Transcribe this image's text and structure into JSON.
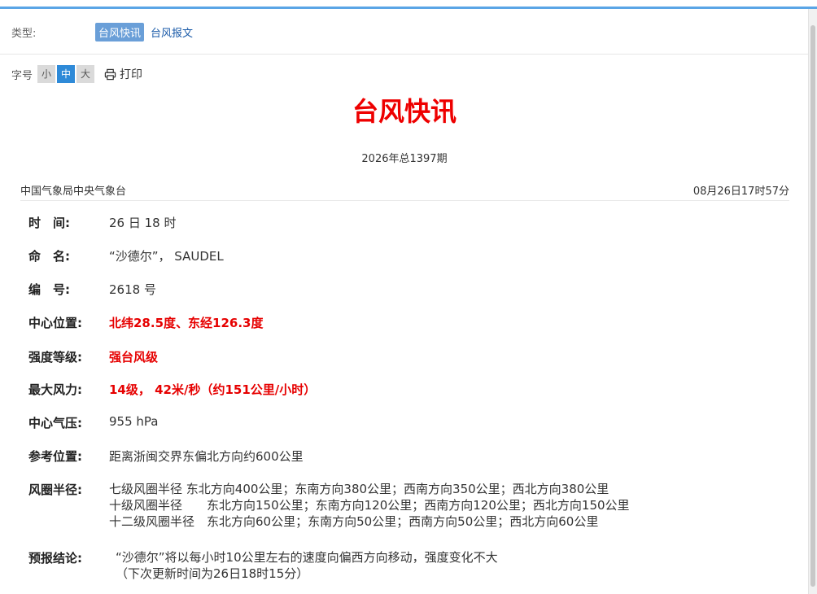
{
  "type_filter": {
    "label": "类型:",
    "active": "台风快讯",
    "other": "台风报文"
  },
  "font_size": {
    "label": "字号",
    "small": "小",
    "medium": "中",
    "large": "大",
    "print": "打印"
  },
  "header": {
    "title": "台风快讯",
    "issue": "2026年总1397期"
  },
  "meta": {
    "org": "中国气象局中央气象台",
    "time": "08月26日17时57分"
  },
  "fields": {
    "time": {
      "label": "时　间:",
      "value": "26 日 18 时"
    },
    "name": {
      "label": "命　名:",
      "value": "“沙德尔”， SAUDEL"
    },
    "number": {
      "label": "编　号:",
      "value": "2618 号"
    },
    "center": {
      "label": "中心位置:",
      "value": "北纬28.5度、东经126.3度"
    },
    "intensity": {
      "label": "强度等级:",
      "value": "强台风级"
    },
    "max_wind": {
      "label": "最大风力:",
      "value": "14级， 42米/秒（约151公里/小时）"
    },
    "pressure": {
      "label": "中心气压:",
      "value": "955 hPa"
    },
    "reference": {
      "label": "参考位置:",
      "value": "距离浙闽交界东偏北方向约600公里"
    },
    "wind_radius": {
      "label": "风圈半径:",
      "lines": [
        "七级风圈半径 东北方向400公里；东南方向380公里；西南方向350公里；西北方向380公里",
        "十级风圈半径　　东北方向150公里；东南方向120公里；西南方向120公里；西北方向150公里",
        "十二级风圈半径　东北方向60公里；东南方向50公里；西南方向50公里；西北方向60公里"
      ]
    },
    "forecast": {
      "label": "预报结论:",
      "lines": [
        "“沙德尔”将以每小时10公里左右的速度向偏西方向移动，强度变化不大",
        "（下次更新时间为26日18时15分）"
      ]
    }
  },
  "colors": {
    "accent_blue": "#2e8ad8",
    "title_red": "#ee0000",
    "value_red": "#e60000"
  }
}
